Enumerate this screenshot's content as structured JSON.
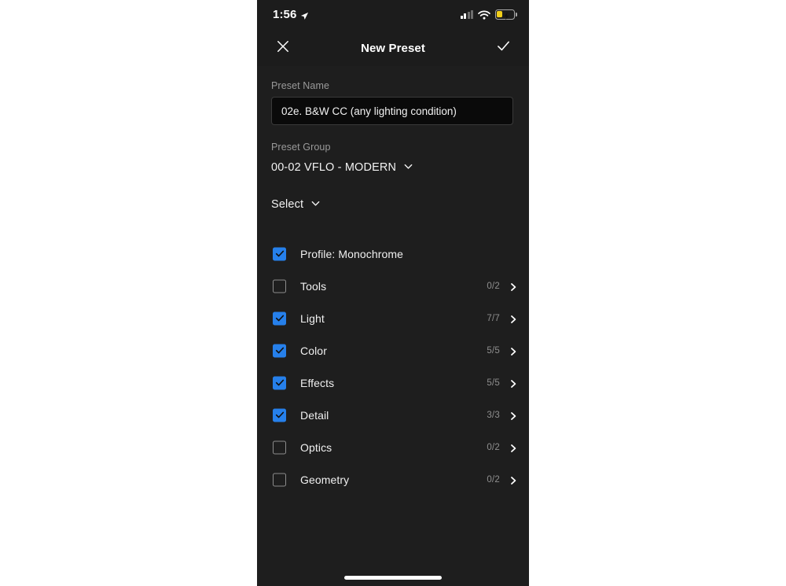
{
  "theme": {
    "screen_bg": "#1e1e1e",
    "header_bg": "#1c1c1c",
    "accent_blue": "#2680eb",
    "text_primary": "#f2f2f2",
    "text_secondary": "#9a9a9a",
    "input_bg": "#0a0a0a",
    "battery_yellow": "#f2cf1a"
  },
  "status_bar": {
    "time": "1:56",
    "location_icon": "location-arrow-icon",
    "signal_icon": "cellular-signal-icon",
    "signal_bars_filled": 2,
    "signal_bars_total": 4,
    "wifi_icon": "wifi-icon",
    "battery_icon": "battery-charging-icon",
    "battery_charging": true,
    "battery_low_power_mode": true
  },
  "nav": {
    "title": "New Preset",
    "close_icon": "close-icon",
    "done_icon": "checkmark-icon"
  },
  "form": {
    "preset_name": {
      "label": "Preset Name",
      "value": "02e. B&W CC (any lighting condition)",
      "placeholder": "Preset Name"
    },
    "preset_group": {
      "label": "Preset Group",
      "value": "00-02 VFLO - MODERN",
      "chevron_icon": "chevron-down-icon"
    },
    "select": {
      "label": "Select",
      "chevron_icon": "chevron-down-icon"
    }
  },
  "settings_list": [
    {
      "label": "Profile: Monochrome",
      "checked": true,
      "count": "",
      "has_chevron": false
    },
    {
      "label": "Tools",
      "checked": false,
      "count": "0/2",
      "has_chevron": true
    },
    {
      "label": "Light",
      "checked": true,
      "count": "7/7",
      "has_chevron": true
    },
    {
      "label": "Color",
      "checked": true,
      "count": "5/5",
      "has_chevron": true
    },
    {
      "label": "Effects",
      "checked": true,
      "count": "5/5",
      "has_chevron": true
    },
    {
      "label": "Detail",
      "checked": true,
      "count": "3/3",
      "has_chevron": true
    },
    {
      "label": "Optics",
      "checked": false,
      "count": "0/2",
      "has_chevron": true
    },
    {
      "label": "Geometry",
      "checked": false,
      "count": "0/2",
      "has_chevron": true
    }
  ],
  "home_indicator": "home-indicator"
}
